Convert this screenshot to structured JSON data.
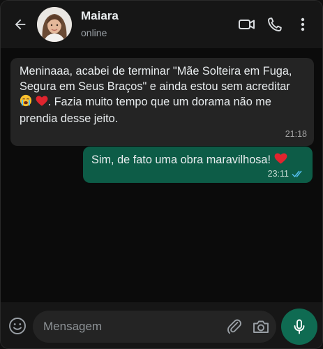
{
  "colors": {
    "header_bg": "#161616",
    "chat_bg": "#0b0b0b",
    "incoming_bubble": "#242424",
    "outgoing_bubble": "#0d5c47",
    "mic_button": "#0f6b52",
    "read_ticks": "#53bdeb"
  },
  "header": {
    "back_icon": "arrow-left-icon",
    "contact_name": "Maiara",
    "contact_status": "online",
    "actions": [
      "video-call-icon",
      "phone-icon",
      "more-vert-icon"
    ]
  },
  "messages": [
    {
      "direction": "incoming",
      "text_part1": "Meninaaa, acabei de terminar \"Mãe Solteira em Fuga, Segura em Seus Braços\" e ainda estou sem acreditar ",
      "emojis_mid": [
        "loudly-crying-face-emoji",
        "red-heart-emoji"
      ],
      "text_part2": ". Fazia muito tempo que um dorama não me prendia desse jeito.",
      "time": "21:18"
    },
    {
      "direction": "outgoing",
      "text": "Sim, de fato uma obra maravilhosa! ",
      "emoji_end": "red-heart-emoji",
      "time": "23:11",
      "status": "read"
    }
  ],
  "composer": {
    "placeholder": "Mensagem",
    "value": "",
    "left_icon": "emoji-icon",
    "attach_icon": "paperclip-icon",
    "camera_icon": "camera-icon",
    "send_icon": "microphone-icon"
  }
}
